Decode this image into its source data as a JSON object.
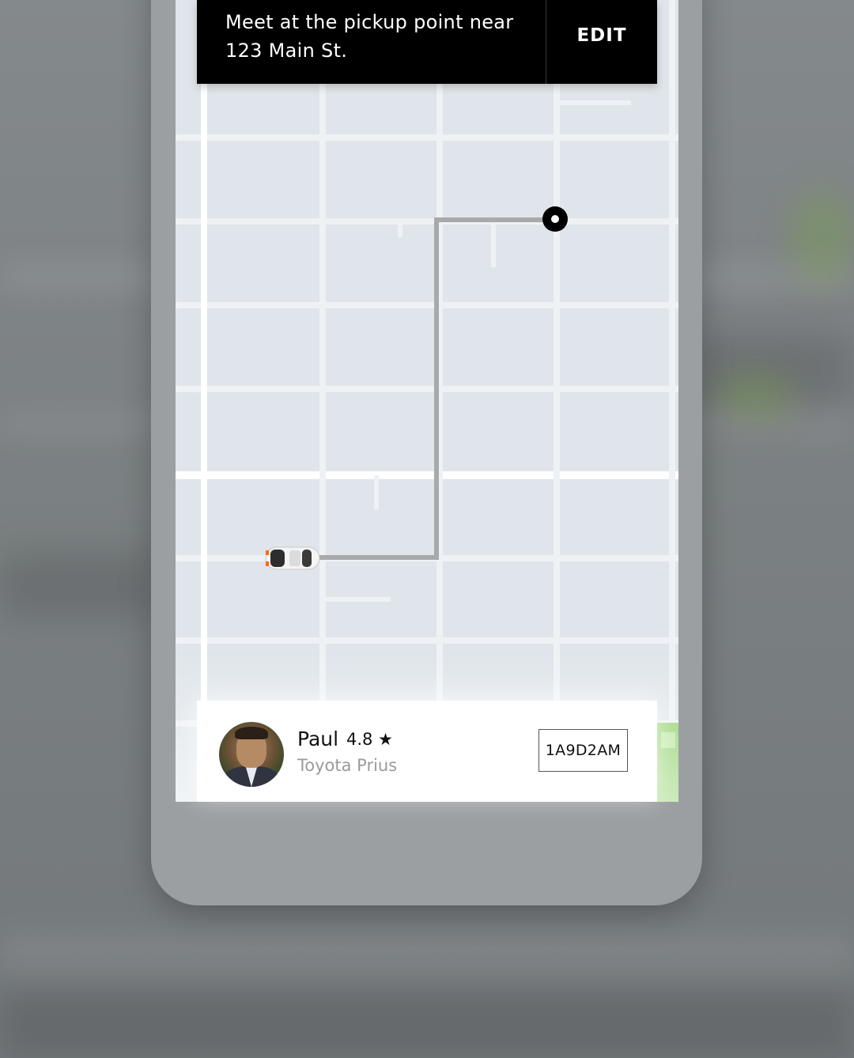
{
  "banner": {
    "line1": "Meet at the pickup point near",
    "line2": "123 Main St.",
    "edit_label": "EDIT"
  },
  "driver": {
    "name": "Paul",
    "rating": "4.8 ★",
    "car": "Toyota Prius",
    "plate": "1A9D2AM"
  },
  "map": {
    "route_color": "#a8a9ab",
    "block_color": "#dfe5ea",
    "street_color": "#f3f6f8",
    "pin_color": "#000000",
    "car_icon": "car-topdown-icon",
    "pin_icon": "pickup-pin-icon"
  }
}
